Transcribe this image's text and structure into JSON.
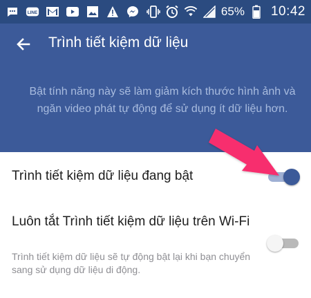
{
  "status_bar": {
    "left_icons": [
      "sms-icon",
      "line-icon",
      "gmail-icon",
      "youtube-icon",
      "gallery-icon",
      "warning-icon",
      "messenger-icon"
    ],
    "right_icons": [
      "vibrate-icon",
      "alarm-icon",
      "wifi-icon",
      "signal-icon",
      "battery-icon"
    ],
    "battery": "65%",
    "time": "10:42"
  },
  "header": {
    "title": "Trình tiết kiệm dữ liệu",
    "description": "Bật tính năng này sẽ làm giảm kích thước hình ảnh và ngăn video phát tự động để sử dụng ít dữ liệu hơn.",
    "background": "#3c5a99"
  },
  "settings": [
    {
      "title": "Trình tiết kiệm dữ liệu đang bật",
      "enabled": true
    },
    {
      "title": "Luôn tắt Trình tiết kiệm dữ liệu trên Wi-Fi",
      "subtitle": "Trình tiết kiệm dữ liệu sẽ tự động bật lại khi bạn chuyển sang sử dụng dữ liệu di động.",
      "enabled": false
    }
  ],
  "colors": {
    "accent": "#3c5a99",
    "annotation_arrow": "#f72f6e"
  }
}
